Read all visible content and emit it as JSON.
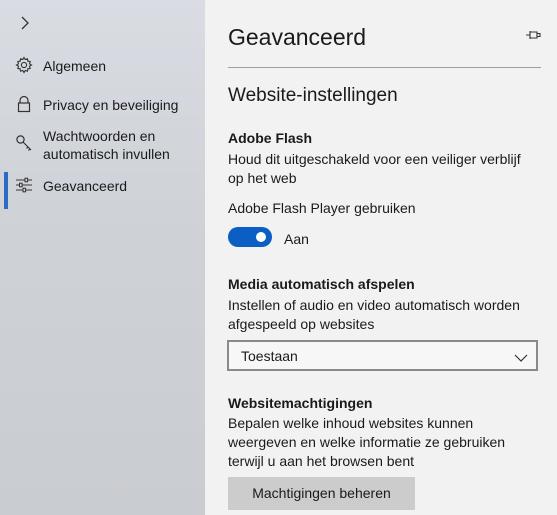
{
  "sidebar": {
    "collapse_icon": "chevron-right-icon",
    "items": [
      {
        "label": "Algemeen",
        "icon": "gear-icon"
      },
      {
        "label": "Privacy en beveiliging",
        "icon": "lock-icon"
      },
      {
        "label": "Wachtwoorden en automatisch invullen",
        "icon": "key-icon"
      },
      {
        "label": "Geavanceerd",
        "icon": "sliders-icon",
        "active": true
      }
    ]
  },
  "main": {
    "title": "Geavanceerd",
    "pin_icon": "pin-icon",
    "section_title": "Website-instellingen",
    "flash": {
      "heading": "Adobe Flash",
      "description": "Houd dit uitgeschakeld voor een veiliger verblijf op het web",
      "toggle_caption": "Adobe Flash Player gebruiken",
      "toggle_state": "Aan",
      "toggle_on": true
    },
    "media": {
      "heading": "Media automatisch afspelen",
      "description": "Instellen of audio en video automatisch worden afgespeeld op websites",
      "selected": "Toestaan"
    },
    "permissions": {
      "heading": "Websitemachtigingen",
      "description": "Bepalen welke inhoud websites kunnen weergeven en welke informatie ze gebruiken terwijl u aan het browsen bent",
      "button_label": "Machtigingen beheren"
    }
  },
  "colors": {
    "accent": "#0a5ec4",
    "active_bar": "#2b6cc4"
  }
}
